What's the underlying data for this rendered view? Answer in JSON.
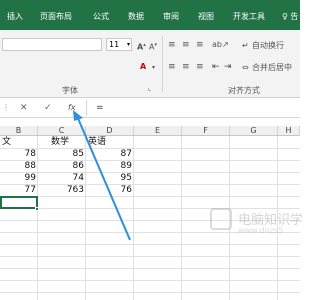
{
  "tabs": [
    "插入",
    "页面布局",
    "公式",
    "数据",
    "审阅",
    "视图",
    "开发工具",
    "♀ 告"
  ],
  "font": {
    "name": "",
    "size": "11",
    "group_label": "字体"
  },
  "align": {
    "wrap_label": "自动换行",
    "merge_label": "合并后居中",
    "group_label": "对齐方式"
  },
  "formula_bar": {
    "cancel": "✕",
    "enter": "✓",
    "fx": "fx",
    "equals": "="
  },
  "columns": [
    "B",
    "C",
    "D",
    "E",
    "F",
    "G",
    "H"
  ],
  "rows": [
    [
      "文",
      "数学",
      "英语"
    ],
    [
      "78",
      "85",
      "87"
    ],
    [
      "88",
      "86",
      "89"
    ],
    [
      "99",
      "74",
      "95"
    ],
    [
      "77",
      "763",
      "76"
    ]
  ],
  "watermark": {
    "title": "电脑知识学",
    "url": "www.dnzs5"
  },
  "colors": {
    "ribbon": "#217346",
    "selection": "#217346",
    "arrow": "#2f8fd8"
  }
}
